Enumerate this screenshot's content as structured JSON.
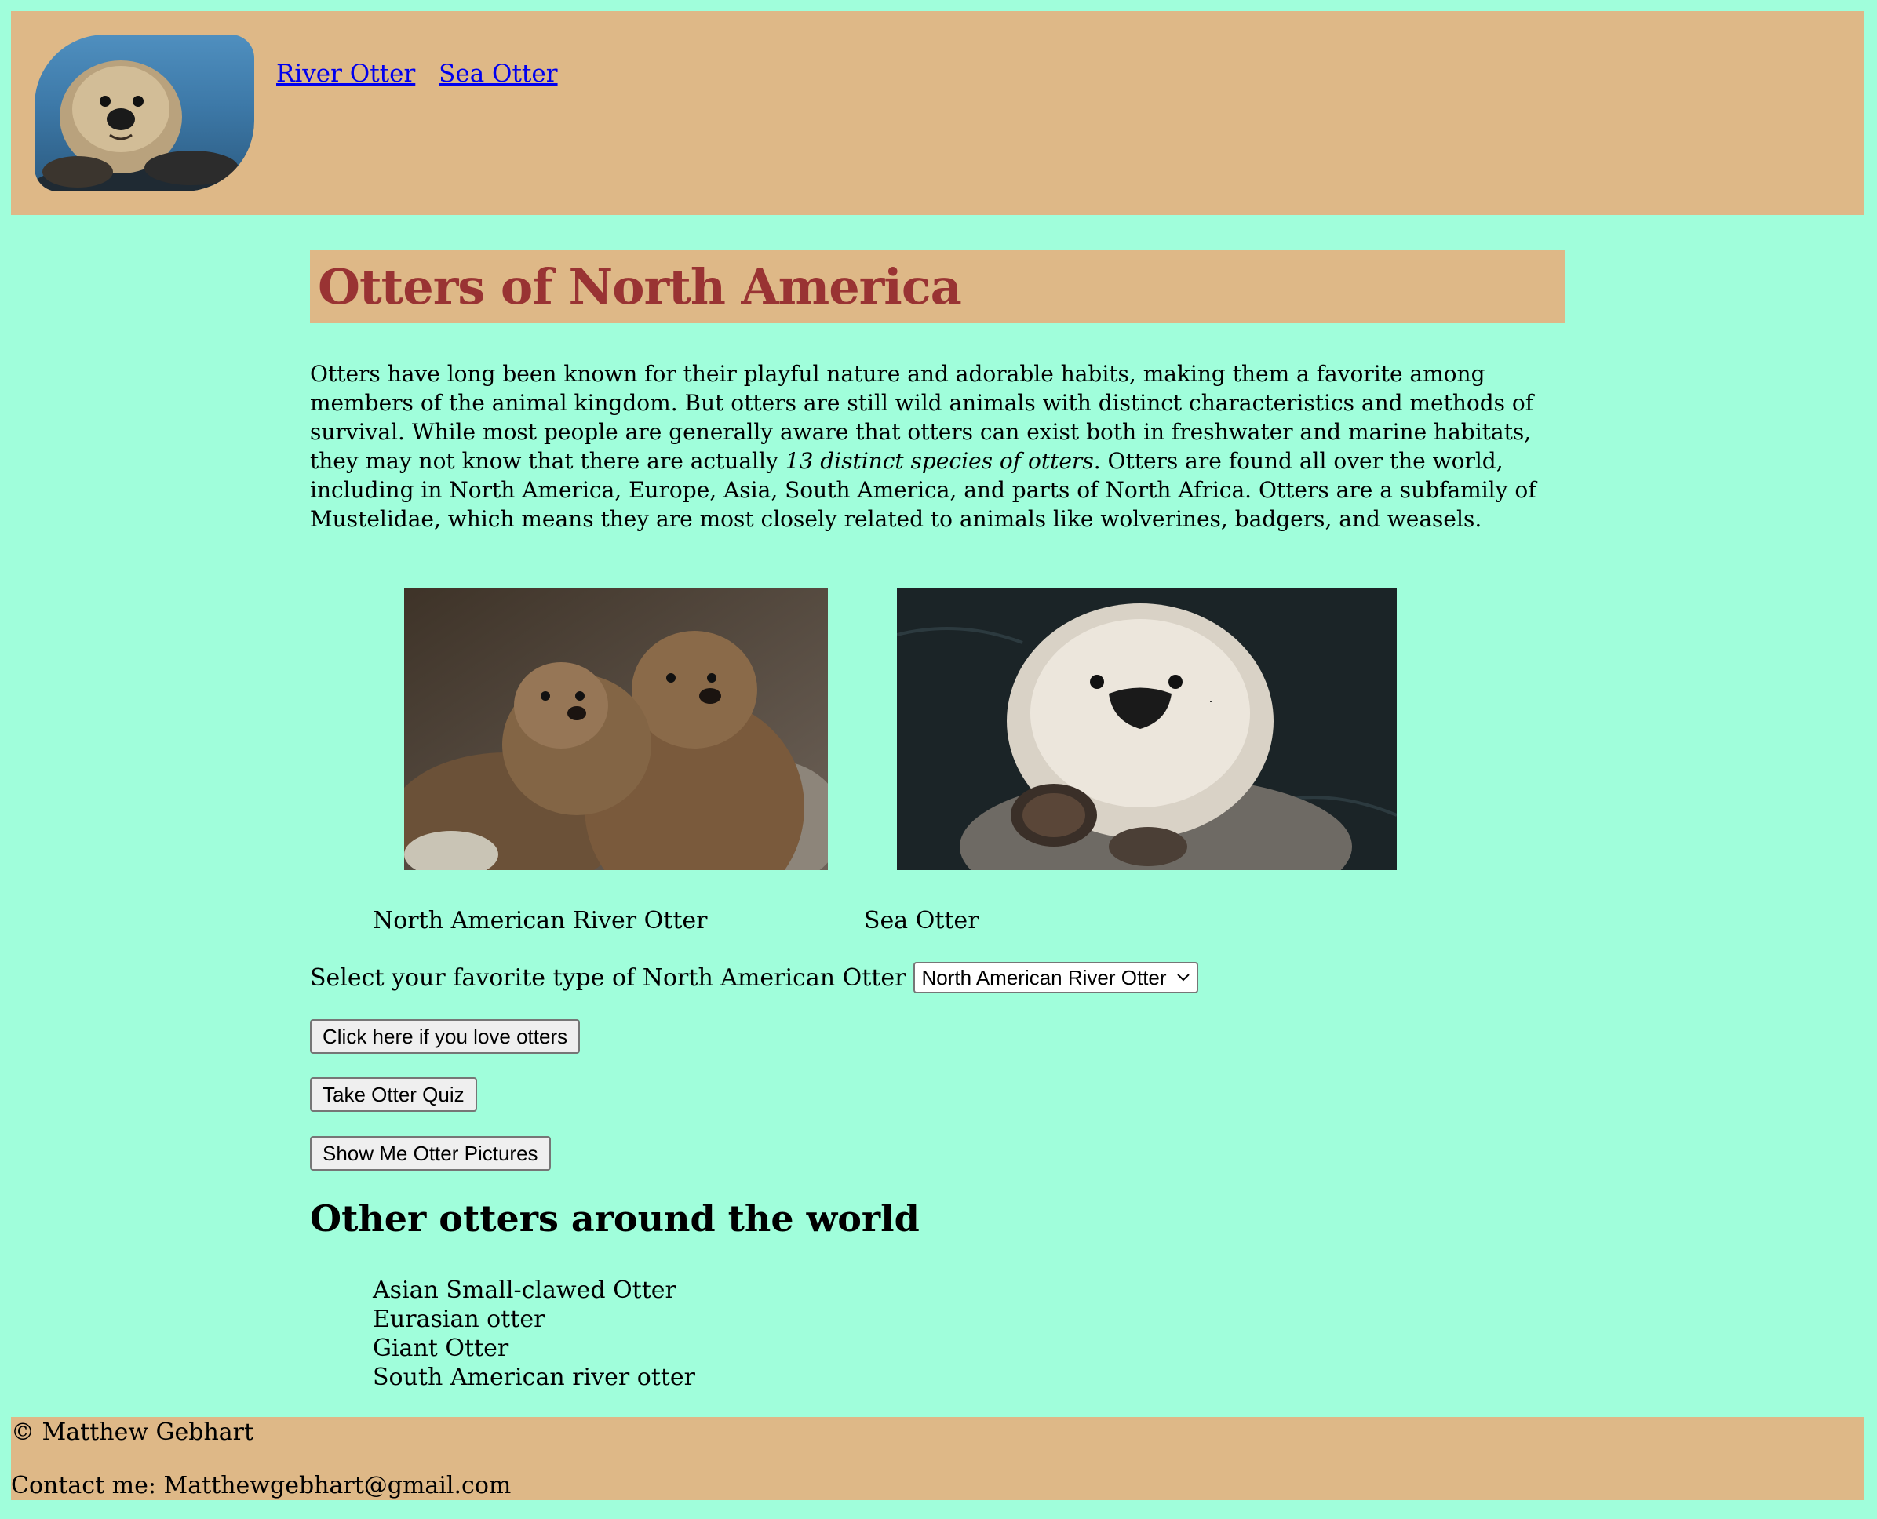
{
  "header": {
    "logo_icon": "sea-otter-logo",
    "nav": [
      {
        "label": "River Otter"
      },
      {
        "label": "Sea Otter"
      }
    ]
  },
  "main": {
    "title": "Otters of North America",
    "intro_part1": "Otters have long been known for their playful nature and adorable habits, making them a favorite among members of the animal kingdom. But otters are still wild animals with distinct characteristics and methods of survival. While most people are generally aware that otters can exist both in freshwater and marine habitats, they may not know that there are actually ",
    "intro_em": "13 distinct species of otters",
    "intro_part2": ". Otters are found all over the world, including in North America, Europe, Asia, South America, and parts of North Africa. Otters are a subfamily of Mustelidae, which means they are most closely related to animals like wolverines, badgers, and weasels.",
    "photos": [
      {
        "caption": "North American River Otter",
        "icon": "river-otters-photo"
      },
      {
        "caption": "Sea Otter",
        "icon": "sea-otter-photo"
      }
    ],
    "select": {
      "label": "Select your favorite type of North American Otter",
      "value": "North American River Otter"
    },
    "buttons": {
      "love": "Click here if you love otters",
      "quiz": "Take Otter Quiz",
      "pictures": "Show Me Otter Pictures"
    },
    "world_heading": "Other otters around the world",
    "world_list": [
      "Asian Small-clawed Otter",
      "Eurasian otter",
      "Giant Otter",
      "South American river otter"
    ]
  },
  "footer": {
    "copyright": "© Matthew Gebhart",
    "contact": "Contact me: Matthewgebhart@gmail.com"
  },
  "colors": {
    "page_bg": "#a0fedb",
    "bar_bg": "#deb887",
    "title_color": "#993333",
    "link": "#0000ee"
  }
}
